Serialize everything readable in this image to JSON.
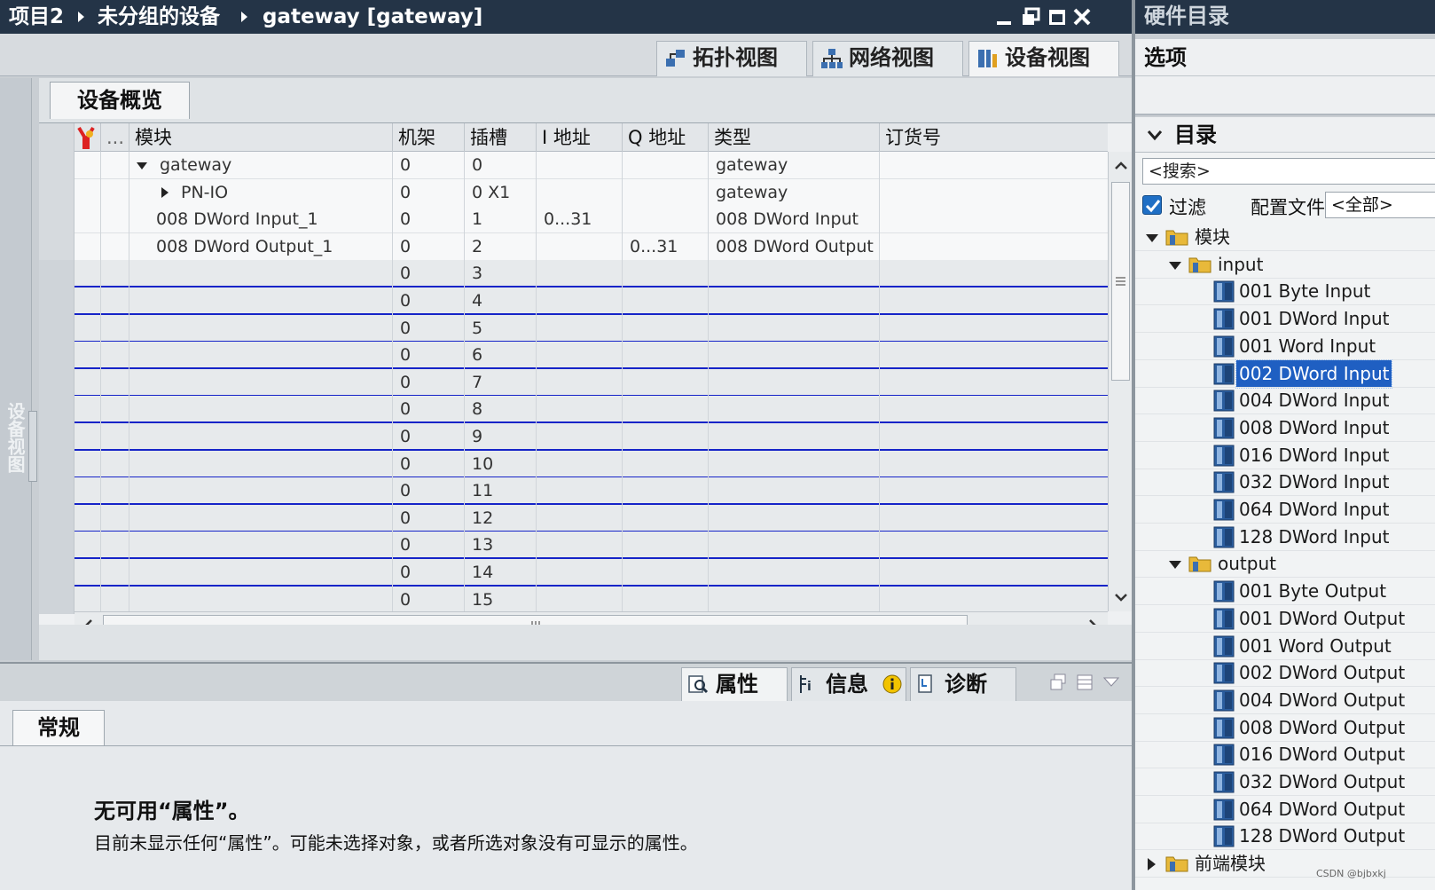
{
  "titlebar": {
    "crumbs": [
      "项目2",
      "未分组的设备",
      "gateway [gateway]"
    ]
  },
  "view_tabs": [
    {
      "label": "拓扑视图",
      "icon": "topology-view-icon"
    },
    {
      "label": "网络视图",
      "icon": "network-view-icon"
    },
    {
      "label": "设备视图",
      "icon": "device-view-icon",
      "active": true
    }
  ],
  "side_label": "设备视图",
  "overview": {
    "tab_label": "设备概览",
    "columns": [
      "...",
      "模块",
      "机架",
      "插槽",
      "I 地址",
      "Q 地址",
      "类型",
      "订货号"
    ],
    "rows": [
      {
        "module": "gateway",
        "rack": "0",
        "slot": "0",
        "i_addr": "",
        "q_addr": "",
        "type": "gateway",
        "order": "",
        "expand": "down"
      },
      {
        "module": "PN-IO",
        "rack": "0",
        "slot": "0 X1",
        "i_addr": "",
        "q_addr": "",
        "type": "gateway",
        "order": "",
        "expand": "right"
      },
      {
        "module": "008 DWord Input_1",
        "rack": "0",
        "slot": "1",
        "i_addr": "0...31",
        "q_addr": "",
        "type": "008 DWord Input",
        "order": ""
      },
      {
        "module": "008 DWord Output_1",
        "rack": "0",
        "slot": "2",
        "i_addr": "",
        "q_addr": "0...31",
        "type": "008 DWord Output",
        "order": ""
      },
      {
        "module": "",
        "rack": "0",
        "slot": "3"
      },
      {
        "module": "",
        "rack": "0",
        "slot": "4"
      },
      {
        "module": "",
        "rack": "0",
        "slot": "5"
      },
      {
        "module": "",
        "rack": "0",
        "slot": "6"
      },
      {
        "module": "",
        "rack": "0",
        "slot": "7"
      },
      {
        "module": "",
        "rack": "0",
        "slot": "8"
      },
      {
        "module": "",
        "rack": "0",
        "slot": "9"
      },
      {
        "module": "",
        "rack": "0",
        "slot": "10"
      },
      {
        "module": "",
        "rack": "0",
        "slot": "11"
      },
      {
        "module": "",
        "rack": "0",
        "slot": "12"
      },
      {
        "module": "",
        "rack": "0",
        "slot": "13"
      },
      {
        "module": "",
        "rack": "0",
        "slot": "14"
      },
      {
        "module": "",
        "rack": "0",
        "slot": "15"
      }
    ]
  },
  "properties": {
    "tabs": [
      {
        "label": "属性",
        "icon": "properties-icon",
        "active": true
      },
      {
        "label": "信息",
        "icon": "info-icon"
      },
      {
        "label": "诊断",
        "icon": "diagnostics-icon"
      }
    ],
    "general_tab": "常规",
    "no_props_title": "无可用“属性”。",
    "no_props_desc": "目前未显示任何“属性”。可能未选择对象，或者所选对象没有可显示的属性。"
  },
  "catalog": {
    "title": "硬件目录",
    "options_label": "选项",
    "catalog_label": "目录",
    "search_placeholder": "<搜索>",
    "filter_label": "过滤",
    "filter_checked": true,
    "profile_label": "配置文件",
    "profile_value": "<全部>",
    "tree": {
      "root": "模块",
      "input_folder": "input",
      "inputs": [
        "001 Byte Input",
        "001 DWord Input",
        "001 Word Input",
        "002 DWord Input",
        "004 DWord Input",
        "008 DWord Input",
        "016 DWord Input",
        "032 DWord Input",
        "064 DWord Input",
        "128 DWord Input"
      ],
      "selected_input": "002 DWord Input",
      "output_folder": "output",
      "outputs": [
        "001 Byte Output",
        "001 DWord Output",
        "001 Word Output",
        "002 DWord Output",
        "004 DWord Output",
        "008 DWord Output",
        "016 DWord Output",
        "032 DWord Output",
        "064 DWord Output",
        "128 DWord Output"
      ],
      "next_root": "前端模块"
    }
  },
  "watermark": "CSDN @bjbxkj",
  "colors": {
    "accent_blue": "#1f5fc2",
    "row_separator": "#1624c8",
    "titlebar": "#243447"
  }
}
